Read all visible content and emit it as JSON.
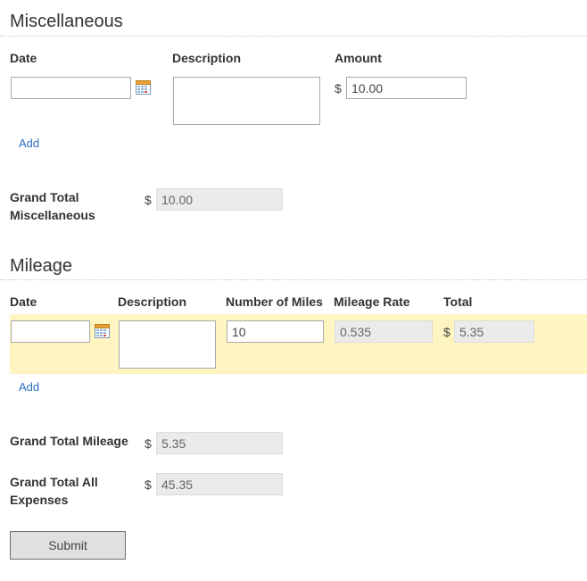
{
  "misc": {
    "title": "Miscellaneous",
    "headers": {
      "date": "Date",
      "description": "Description",
      "amount": "Amount"
    },
    "row": {
      "date": "",
      "description": "",
      "currency": "$",
      "amount": "10.00"
    },
    "add_label": "Add",
    "grand_total": {
      "label": "Grand Total Miscellaneous",
      "currency": "$",
      "value": "10.00"
    }
  },
  "mileage": {
    "title": "Mileage",
    "headers": {
      "date": "Date",
      "description": "Description",
      "miles": "Number of Miles",
      "rate": "Mileage Rate",
      "total": "Total"
    },
    "row": {
      "date": "",
      "description": "",
      "miles": "10",
      "rate": "0.535",
      "currency": "$",
      "total": "5.35"
    },
    "add_label": "Add",
    "grand_total": {
      "label": "Grand Total Mileage",
      "currency": "$",
      "value": "5.35"
    }
  },
  "all": {
    "label": "Grand Total All Expenses",
    "currency": "$",
    "value": "45.35"
  },
  "submit_label": "Submit",
  "colors": {
    "accent_link": "#2a6ebb",
    "row_highlight": "#fff5c0",
    "readonly_bg": "#ebebeb"
  },
  "icons": {
    "date_picker": "calendar-icon"
  }
}
